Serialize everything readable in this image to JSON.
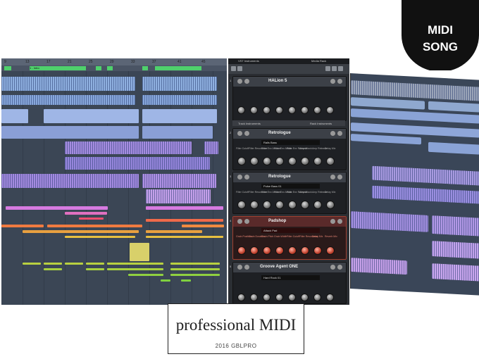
{
  "badge": {
    "line1": "MIDI",
    "line2": "SONG",
    "color": "#111111"
  },
  "caption": {
    "title": "professional MIDI",
    "subtitle": "2016 GBLPRO"
  },
  "daw": {
    "ruler_ticks": [
      "9",
      "13",
      "17",
      "21",
      "25",
      "29",
      "33",
      "37",
      "41",
      "45"
    ],
    "markers": [
      {
        "label": "1 - Intro"
      }
    ]
  },
  "rack": {
    "tabs": [
      "VST Instruments",
      "Media Rack"
    ],
    "track_bar_left": "Track Instruments",
    "track_bar_right": "Rack Instruments",
    "slots": [
      {
        "num": "1",
        "name": "HALion 5"
      },
      {
        "num": "2",
        "name": "Retrologue",
        "preset": "Rails Bass",
        "params": [
          "Filter Cutoff",
          "Filter Resonance",
          "Filter Env Amount",
          "Filter Env Attack",
          "Filter Env Release",
          "Amp Attack",
          "Amp Release",
          "Delay Mix"
        ]
      },
      {
        "num": "3",
        "name": "Retrologue",
        "preset": "Pulse Bass 01",
        "params": [
          "Filter Cutoff",
          "Filter Resonance",
          "Filter Env Amount",
          "Filter Env Attack",
          "Filter Env Release",
          "Amp Attack",
          "Amp Release",
          "Delay Mix"
        ]
      },
      {
        "num": "4",
        "name": "Padshop",
        "preset": "Attack Pad",
        "params": [
          "Grain Position",
          "Grain Duration",
          "Grain Pitch",
          "Grain Width",
          "Filter Cutoff",
          "Filter Resonance",
          "Delay Mix",
          "Reverb Mix"
        ]
      },
      {
        "num": "5",
        "name": "Groove Agent ONE",
        "preset": "Hard Rock 01"
      }
    ]
  }
}
